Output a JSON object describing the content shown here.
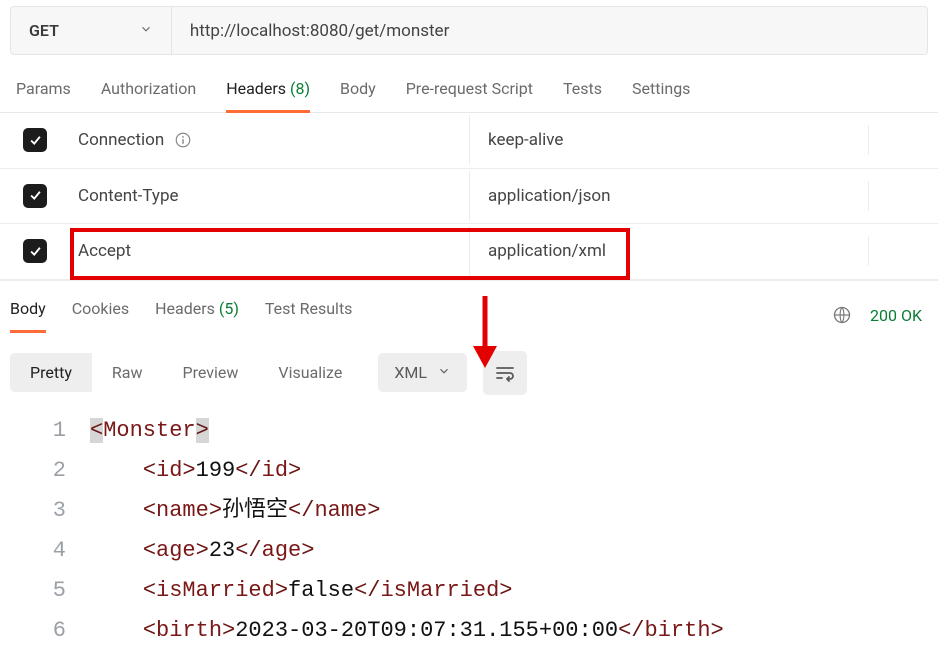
{
  "request": {
    "method": "GET",
    "url": "http://localhost:8080/get/monster"
  },
  "request_tabs": {
    "params": "Params",
    "authorization": "Authorization",
    "headers_label": "Headers",
    "headers_count": "(8)",
    "body": "Body",
    "prerequest": "Pre-request Script",
    "tests": "Tests",
    "settings": "Settings"
  },
  "headers": [
    {
      "key": "Connection",
      "value": "keep-alive",
      "has_info": true
    },
    {
      "key": "Content-Type",
      "value": "application/json",
      "has_info": false
    },
    {
      "key": "Accept",
      "value": "application/xml",
      "has_info": false
    }
  ],
  "response_tabs": {
    "body": "Body",
    "cookies": "Cookies",
    "headers_label": "Headers",
    "headers_count": "(5)",
    "test_results": "Test Results"
  },
  "status": "200 OK",
  "body_view": {
    "pretty": "Pretty",
    "raw": "Raw",
    "preview": "Preview",
    "visualize": "Visualize",
    "lang": "XML"
  },
  "xml": {
    "root": "Monster",
    "lines": [
      {
        "open": "id",
        "text": "199",
        "close": "id"
      },
      {
        "open": "name",
        "text": "孙悟空",
        "close": "name"
      },
      {
        "open": "age",
        "text": "23",
        "close": "age"
      },
      {
        "open": "isMarried",
        "text": "false",
        "close": "isMarried"
      },
      {
        "open": "birth",
        "text": "2023-03-20T09:07:31.155+00:00",
        "close": "birth"
      }
    ]
  },
  "line_numbers": [
    "1",
    "2",
    "3",
    "4",
    "5",
    "6"
  ]
}
